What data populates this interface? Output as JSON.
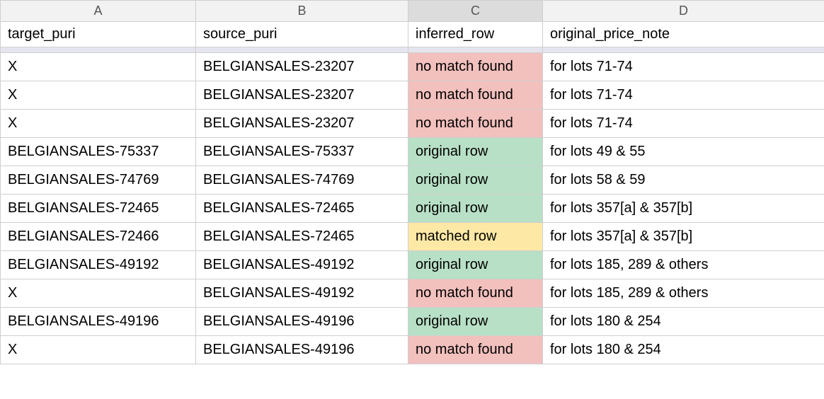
{
  "columns": [
    {
      "letter": "A",
      "selected": false
    },
    {
      "letter": "B",
      "selected": false
    },
    {
      "letter": "C",
      "selected": true
    },
    {
      "letter": "D",
      "selected": false
    }
  ],
  "headers": {
    "a": "target_puri",
    "b": "source_puri",
    "c": "inferred_row",
    "d": "original_price_note"
  },
  "rows": [
    {
      "a": "X",
      "b": "BELGIANSALES-23207",
      "c": "no match found",
      "c_class": "red",
      "d": "for lots 71-74"
    },
    {
      "a": "X",
      "b": "BELGIANSALES-23207",
      "c": "no match found",
      "c_class": "red",
      "d": "for lots 71-74"
    },
    {
      "a": "X",
      "b": "BELGIANSALES-23207",
      "c": "no match found",
      "c_class": "red",
      "d": "for lots 71-74"
    },
    {
      "a": "BELGIANSALES-75337",
      "b": "BELGIANSALES-75337",
      "c": "original row",
      "c_class": "green",
      "d": "for lots 49 & 55"
    },
    {
      "a": "BELGIANSALES-74769",
      "b": "BELGIANSALES-74769",
      "c": "original row",
      "c_class": "green",
      "d": "for lots 58 & 59"
    },
    {
      "a": "BELGIANSALES-72465",
      "b": "BELGIANSALES-72465",
      "c": "original row",
      "c_class": "green",
      "d": "for lots 357[a] & 357[b]"
    },
    {
      "a": "BELGIANSALES-72466",
      "b": "BELGIANSALES-72465",
      "c": "matched row",
      "c_class": "yellow",
      "d": "for lots 357[a] & 357[b]"
    },
    {
      "a": "BELGIANSALES-49192",
      "b": "BELGIANSALES-49192",
      "c": "original row",
      "c_class": "green",
      "d": "for lots 185, 289 & others"
    },
    {
      "a": "X",
      "b": "BELGIANSALES-49192",
      "c": "no match found",
      "c_class": "red",
      "d": "for lots 185, 289 & others"
    },
    {
      "a": "BELGIANSALES-49196",
      "b": "BELGIANSALES-49196",
      "c": "original row",
      "c_class": "green",
      "d": "for lots 180 & 254"
    },
    {
      "a": "X",
      "b": "BELGIANSALES-49196",
      "c": "no match found",
      "c_class": "red",
      "d": "for lots 180 & 254"
    }
  ],
  "chart_data": {
    "type": "table",
    "columns": [
      "target_puri",
      "source_puri",
      "inferred_row",
      "original_price_note"
    ],
    "rows": [
      [
        "X",
        "BELGIANSALES-23207",
        "no match found",
        "for lots 71-74"
      ],
      [
        "X",
        "BELGIANSALES-23207",
        "no match found",
        "for lots 71-74"
      ],
      [
        "X",
        "BELGIANSALES-23207",
        "no match found",
        "for lots 71-74"
      ],
      [
        "BELGIANSALES-75337",
        "BELGIANSALES-75337",
        "original row",
        "for lots 49 & 55"
      ],
      [
        "BELGIANSALES-74769",
        "BELGIANSALES-74769",
        "original row",
        "for lots 58 & 59"
      ],
      [
        "BELGIANSALES-72465",
        "BELGIANSALES-72465",
        "original row",
        "for lots 357[a] & 357[b]"
      ],
      [
        "BELGIANSALES-72466",
        "BELGIANSALES-72465",
        "matched row",
        "for lots 357[a] & 357[b]"
      ],
      [
        "BELGIANSALES-49192",
        "BELGIANSALES-49192",
        "original row",
        "for lots 185, 289 & others"
      ],
      [
        "X",
        "BELGIANSALES-49192",
        "no match found",
        "for lots 185, 289 & others"
      ],
      [
        "BELGIANSALES-49196",
        "BELGIANSALES-49196",
        "original row",
        "for lots 180 & 254"
      ],
      [
        "X",
        "BELGIANSALES-49196",
        "no match found",
        "for lots 180 & 254"
      ]
    ]
  }
}
